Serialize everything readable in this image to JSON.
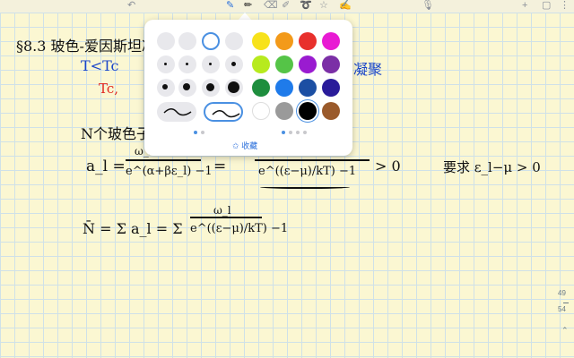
{
  "toolbar": {
    "icons": [
      "undo-icon",
      "pen-icon",
      "pencil-icon",
      "eraser-icon",
      "lasso-icon",
      "shapes-icon",
      "image-icon",
      "mic-icon",
      "add-page-icon",
      "more-icon"
    ]
  },
  "notes": {
    "title": "§8.3 玻色-爱因斯坦凝聚",
    "line_blue": "T<Tc",
    "line_red": "Tc,",
    "line_blue_right": "凝聚",
    "line_n": "N个玻色子",
    "eq1_left": "a_l =",
    "eq1_num": "ω_l",
    "eq1_den": "e^(α+βε_l) −1",
    "eq1_mid": "=",
    "eq1_den2": "e^((ε−μ)/kT) −1",
    "eq1_gt": "> 0",
    "eq1_req": "要求 ε_l−μ > 0",
    "eq2_left": "N̄ = Σ a_l = Σ",
    "eq2_num": "ω_l",
    "eq2_den": "e^((ε−μ)/kT) −1"
  },
  "palette": {
    "collect_label": "收藏",
    "colors": [
      "#f7e21b",
      "#f39a1a",
      "#e8302c",
      "#e81bd3",
      "#b7ea1e",
      "#55c447",
      "#9a1bd0",
      "#7b2fa6",
      "#1e8e3e",
      "#1f7bea",
      "#1c4fa3",
      "#2a1c9a",
      "#ffffff",
      "#9a9a9a",
      "#000000",
      "#9a5a2b"
    ],
    "selected_color": "#000000",
    "page_indicator": {
      "pages": 2,
      "current": 1
    },
    "color_pages": {
      "pages": 4,
      "current": 1
    }
  },
  "page_numbers": {
    "current": "49",
    "total": "54"
  }
}
